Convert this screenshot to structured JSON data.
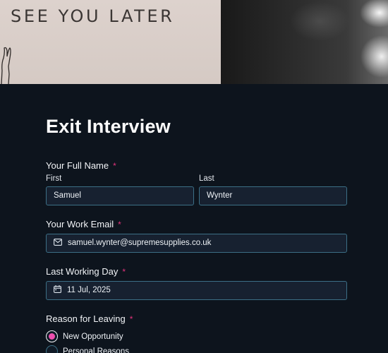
{
  "hero": {
    "sign_text": "SEE YOU LATER"
  },
  "form": {
    "title": "Exit Interview",
    "name_field": {
      "label": "Your Full Name",
      "required_marker": "*",
      "first_label": "First",
      "first_value": "Samuel",
      "last_label": "Last",
      "last_value": "Wynter"
    },
    "email_field": {
      "label": "Your Work Email",
      "required_marker": "*",
      "value": "samuel.wynter@supremesupplies.co.uk",
      "icon": "envelope-icon"
    },
    "date_field": {
      "label": "Last Working Day",
      "required_marker": "*",
      "value": "11 Jul, 2025",
      "icon": "calendar-icon"
    },
    "reason_field": {
      "label": "Reason for Leaving",
      "required_marker": "*",
      "options": [
        {
          "label": "New Opportunity",
          "selected": true
        },
        {
          "label": "Personal Reasons",
          "selected": false
        }
      ]
    }
  },
  "colors": {
    "background": "#0d141d",
    "input_bg": "#172130",
    "input_border": "#3c6f86",
    "required": "#e2337c",
    "radio_selected": "#ee4fae"
  }
}
